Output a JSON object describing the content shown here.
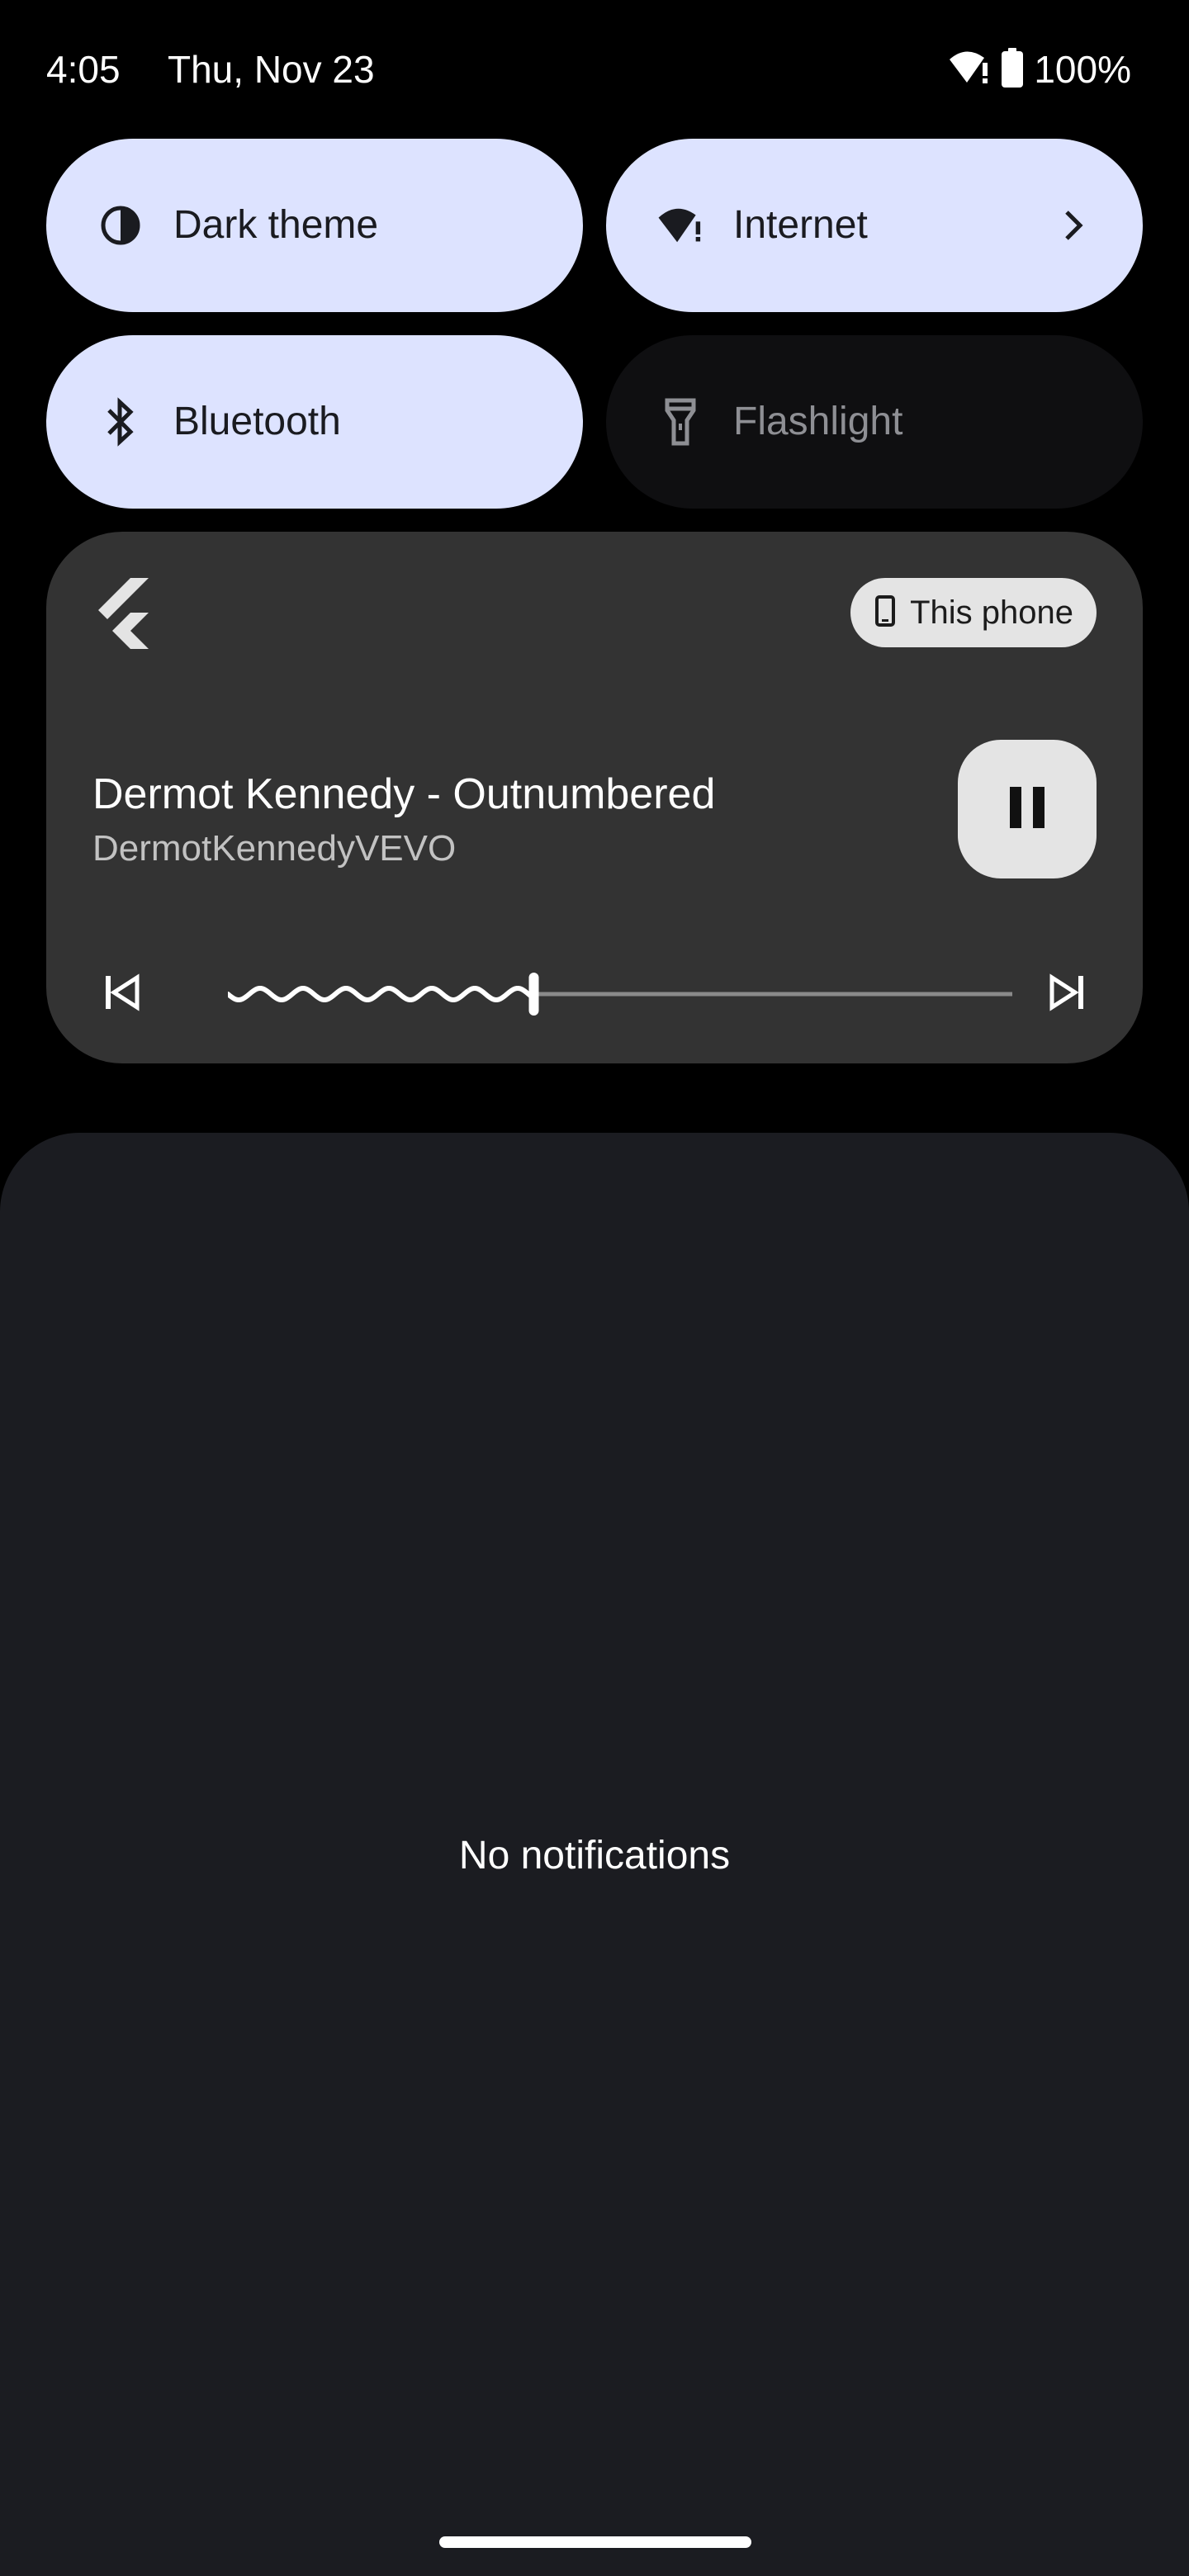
{
  "status_bar": {
    "time": "4:05",
    "date": "Thu, Nov 23",
    "battery_percent": "100%",
    "icons": [
      "wifi-alert-icon",
      "battery-full-icon"
    ]
  },
  "quick_settings": {
    "tiles": [
      {
        "label": "Dark theme",
        "state": "on",
        "icon": "dark-theme-icon"
      },
      {
        "label": "Internet",
        "state": "on",
        "icon": "wifi-alert-icon",
        "has_chevron": true
      },
      {
        "label": "Bluetooth",
        "state": "on",
        "icon": "bluetooth-icon"
      },
      {
        "label": "Flashlight",
        "state": "off",
        "icon": "flashlight-icon"
      }
    ]
  },
  "media": {
    "app_icon": "flutter-logo-icon",
    "output_device": "This phone",
    "title": "Dermot Kennedy - Outnumbered",
    "artist": "DermotKennedyVEVO",
    "progress": 0.39,
    "state": "playing"
  },
  "notifications": {
    "empty_text": "No notifications"
  },
  "colors": {
    "tile_on": "#dde3ff",
    "tile_off": "#0f0f11",
    "media_card": "#333333",
    "notif_panel": "#1b1c21"
  }
}
